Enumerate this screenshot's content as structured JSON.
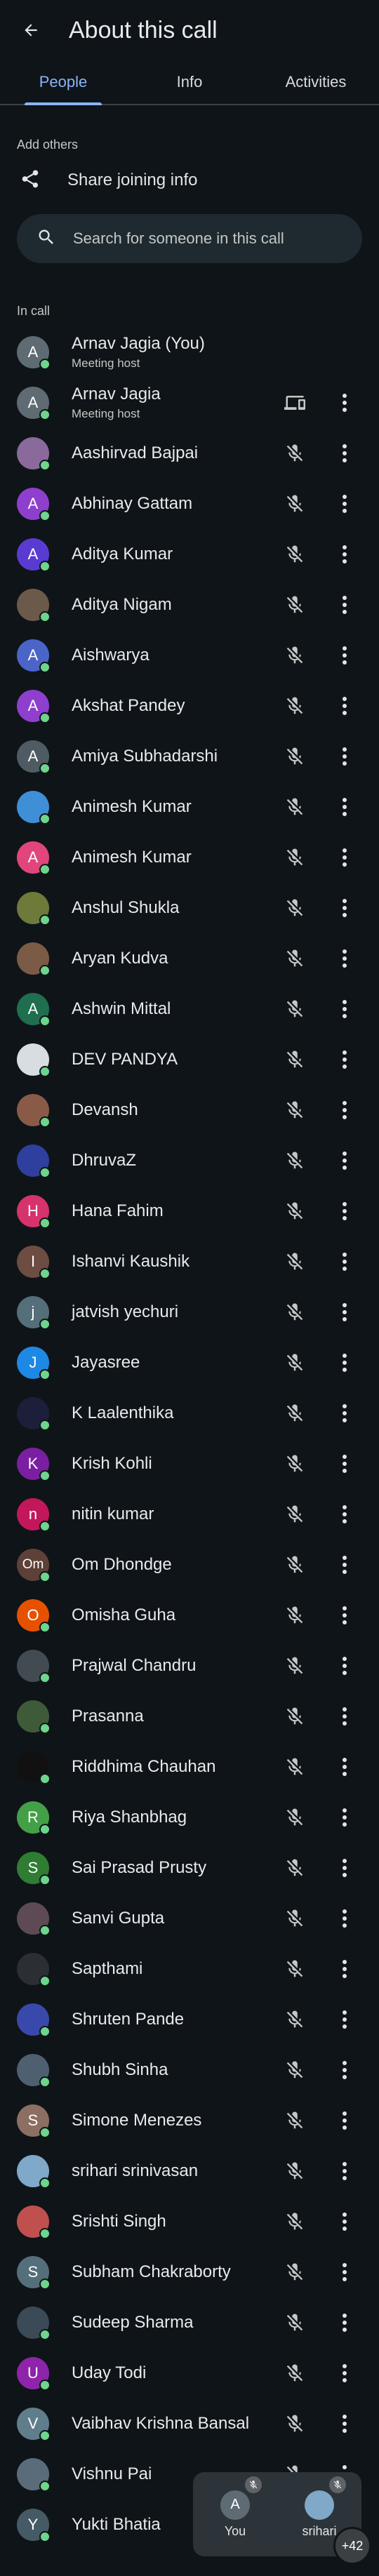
{
  "header": {
    "title": "About this call"
  },
  "tabs": [
    {
      "label": "People",
      "active": true
    },
    {
      "label": "Info",
      "active": false
    },
    {
      "label": "Activities",
      "active": false
    }
  ],
  "add_others": {
    "label": "Add others",
    "share_label": "Share joining info"
  },
  "search": {
    "placeholder": "Search for someone in this call"
  },
  "in_call": {
    "label": "In call"
  },
  "participants": [
    {
      "name": "Arnav Jagia (You)",
      "sub": "Meeting host",
      "initial": "A",
      "color": "#5f6b73",
      "trailing": "none"
    },
    {
      "name": "Arnav Jagia",
      "sub": "Meeting host",
      "initial": "A",
      "color": "#5f6b73",
      "trailing": "device"
    },
    {
      "name": "Aashirvad Bajpai",
      "initial": "",
      "color": "#8a6a9b",
      "trailing": "muted"
    },
    {
      "name": "Abhinay Gattam",
      "initial": "A",
      "color": "#8e3fce",
      "trailing": "muted"
    },
    {
      "name": "Aditya Kumar",
      "initial": "A",
      "color": "#5a3bd1",
      "trailing": "muted"
    },
    {
      "name": "Aditya Nigam",
      "initial": "",
      "color": "#6b5a4a",
      "trailing": "muted"
    },
    {
      "name": "Aishwarya",
      "initial": "A",
      "color": "#4a64c8",
      "trailing": "muted"
    },
    {
      "name": "Akshat Pandey",
      "initial": "A",
      "color": "#8e3fce",
      "trailing": "muted"
    },
    {
      "name": "Amiya Subhadarshi",
      "initial": "A",
      "color": "#4f5b63",
      "trailing": "muted"
    },
    {
      "name": "Animesh Kumar",
      "initial": "",
      "color": "#3e8fd6",
      "trailing": "muted"
    },
    {
      "name": "Animesh Kumar",
      "initial": "A",
      "color": "#e0457b",
      "trailing": "muted"
    },
    {
      "name": "Anshul Shukla",
      "initial": "",
      "color": "#6d7a3a",
      "trailing": "muted"
    },
    {
      "name": "Aryan Kudva",
      "initial": "",
      "color": "#7b5b45",
      "trailing": "muted"
    },
    {
      "name": "Ashwin Mittal",
      "initial": "A",
      "color": "#1f6e50",
      "trailing": "muted"
    },
    {
      "name": "DEV PANDYA",
      "initial": "",
      "color": "#d8dde2",
      "trailing": "muted"
    },
    {
      "name": "Devansh",
      "initial": "",
      "color": "#8a5a48",
      "trailing": "muted"
    },
    {
      "name": "DhruvaZ",
      "initial": "",
      "color": "#2e3f9e",
      "trailing": "muted"
    },
    {
      "name": "Hana Fahim",
      "initial": "H",
      "color": "#d6336c",
      "trailing": "muted"
    },
    {
      "name": "Ishanvi Kaushik",
      "initial": "I",
      "color": "#6d4c41",
      "trailing": "muted"
    },
    {
      "name": "jatvish yechuri",
      "initial": "j",
      "color": "#546e7a",
      "trailing": "muted"
    },
    {
      "name": "Jayasree",
      "initial": "J",
      "color": "#1e88e5",
      "trailing": "muted"
    },
    {
      "name": "K Laalenthika",
      "initial": "",
      "color": "#1c1f3a",
      "trailing": "muted"
    },
    {
      "name": "Krish Kohli",
      "initial": "K",
      "color": "#7b1fa2",
      "trailing": "muted"
    },
    {
      "name": "nitin kumar",
      "initial": "n",
      "color": "#c2185b",
      "trailing": "muted"
    },
    {
      "name": "Om Dhondge",
      "initial": "Om",
      "color": "#5d4037",
      "trailing": "muted"
    },
    {
      "name": "Omisha Guha",
      "initial": "O",
      "color": "#e65100",
      "trailing": "muted"
    },
    {
      "name": "Prajwal Chandru",
      "initial": "",
      "color": "#424b52",
      "trailing": "muted"
    },
    {
      "name": "Prasanna",
      "initial": "",
      "color": "#3f5a38",
      "trailing": "muted"
    },
    {
      "name": "Riddhima Chauhan",
      "initial": "",
      "color": "#111111",
      "trailing": "muted"
    },
    {
      "name": "Riya Shanbhag",
      "initial": "R",
      "color": "#43a047",
      "trailing": "muted"
    },
    {
      "name": "Sai Prasad Prusty",
      "initial": "S",
      "color": "#2e7d32",
      "trailing": "muted"
    },
    {
      "name": "Sanvi Gupta",
      "initial": "",
      "color": "#5e4a55",
      "trailing": "muted"
    },
    {
      "name": "Sapthami",
      "initial": "",
      "color": "#2b2f33",
      "trailing": "muted"
    },
    {
      "name": "Shruten Pande",
      "initial": "",
      "color": "#3949ab",
      "trailing": "muted"
    },
    {
      "name": "Shubh Sinha",
      "initial": "",
      "color": "#4e5f70",
      "trailing": "muted"
    },
    {
      "name": "Simone Menezes",
      "initial": "S",
      "color": "#8d6e63",
      "trailing": "muted"
    },
    {
      "name": "srihari srinivasan",
      "initial": "",
      "color": "#7fa8c9",
      "trailing": "muted"
    },
    {
      "name": "Srishti Singh",
      "initial": "",
      "color": "#c0504d",
      "trailing": "muted"
    },
    {
      "name": "Subham Chakraborty",
      "initial": "S",
      "color": "#546e7a",
      "trailing": "muted"
    },
    {
      "name": "Sudeep Sharma",
      "initial": "",
      "color": "#3a4a56",
      "trailing": "muted"
    },
    {
      "name": "Uday Todi",
      "initial": "U",
      "color": "#8e24aa",
      "trailing": "muted"
    },
    {
      "name": "Vaibhav Krishna Bansal",
      "initial": "V",
      "color": "#607d8b",
      "trailing": "muted"
    },
    {
      "name": "Vishnu Pai",
      "initial": "",
      "color": "#5a6c7a",
      "trailing": "muted"
    },
    {
      "name": "Yukti Bhatia",
      "initial": "Y",
      "color": "#455a64",
      "trailing": "muted"
    }
  ],
  "pip": {
    "tiles": [
      {
        "label": "You",
        "initial": "A",
        "color": "#5f6b73"
      },
      {
        "label": "srihari",
        "initial": "",
        "color": "#7fa8c9"
      }
    ],
    "more_count": "+42"
  }
}
